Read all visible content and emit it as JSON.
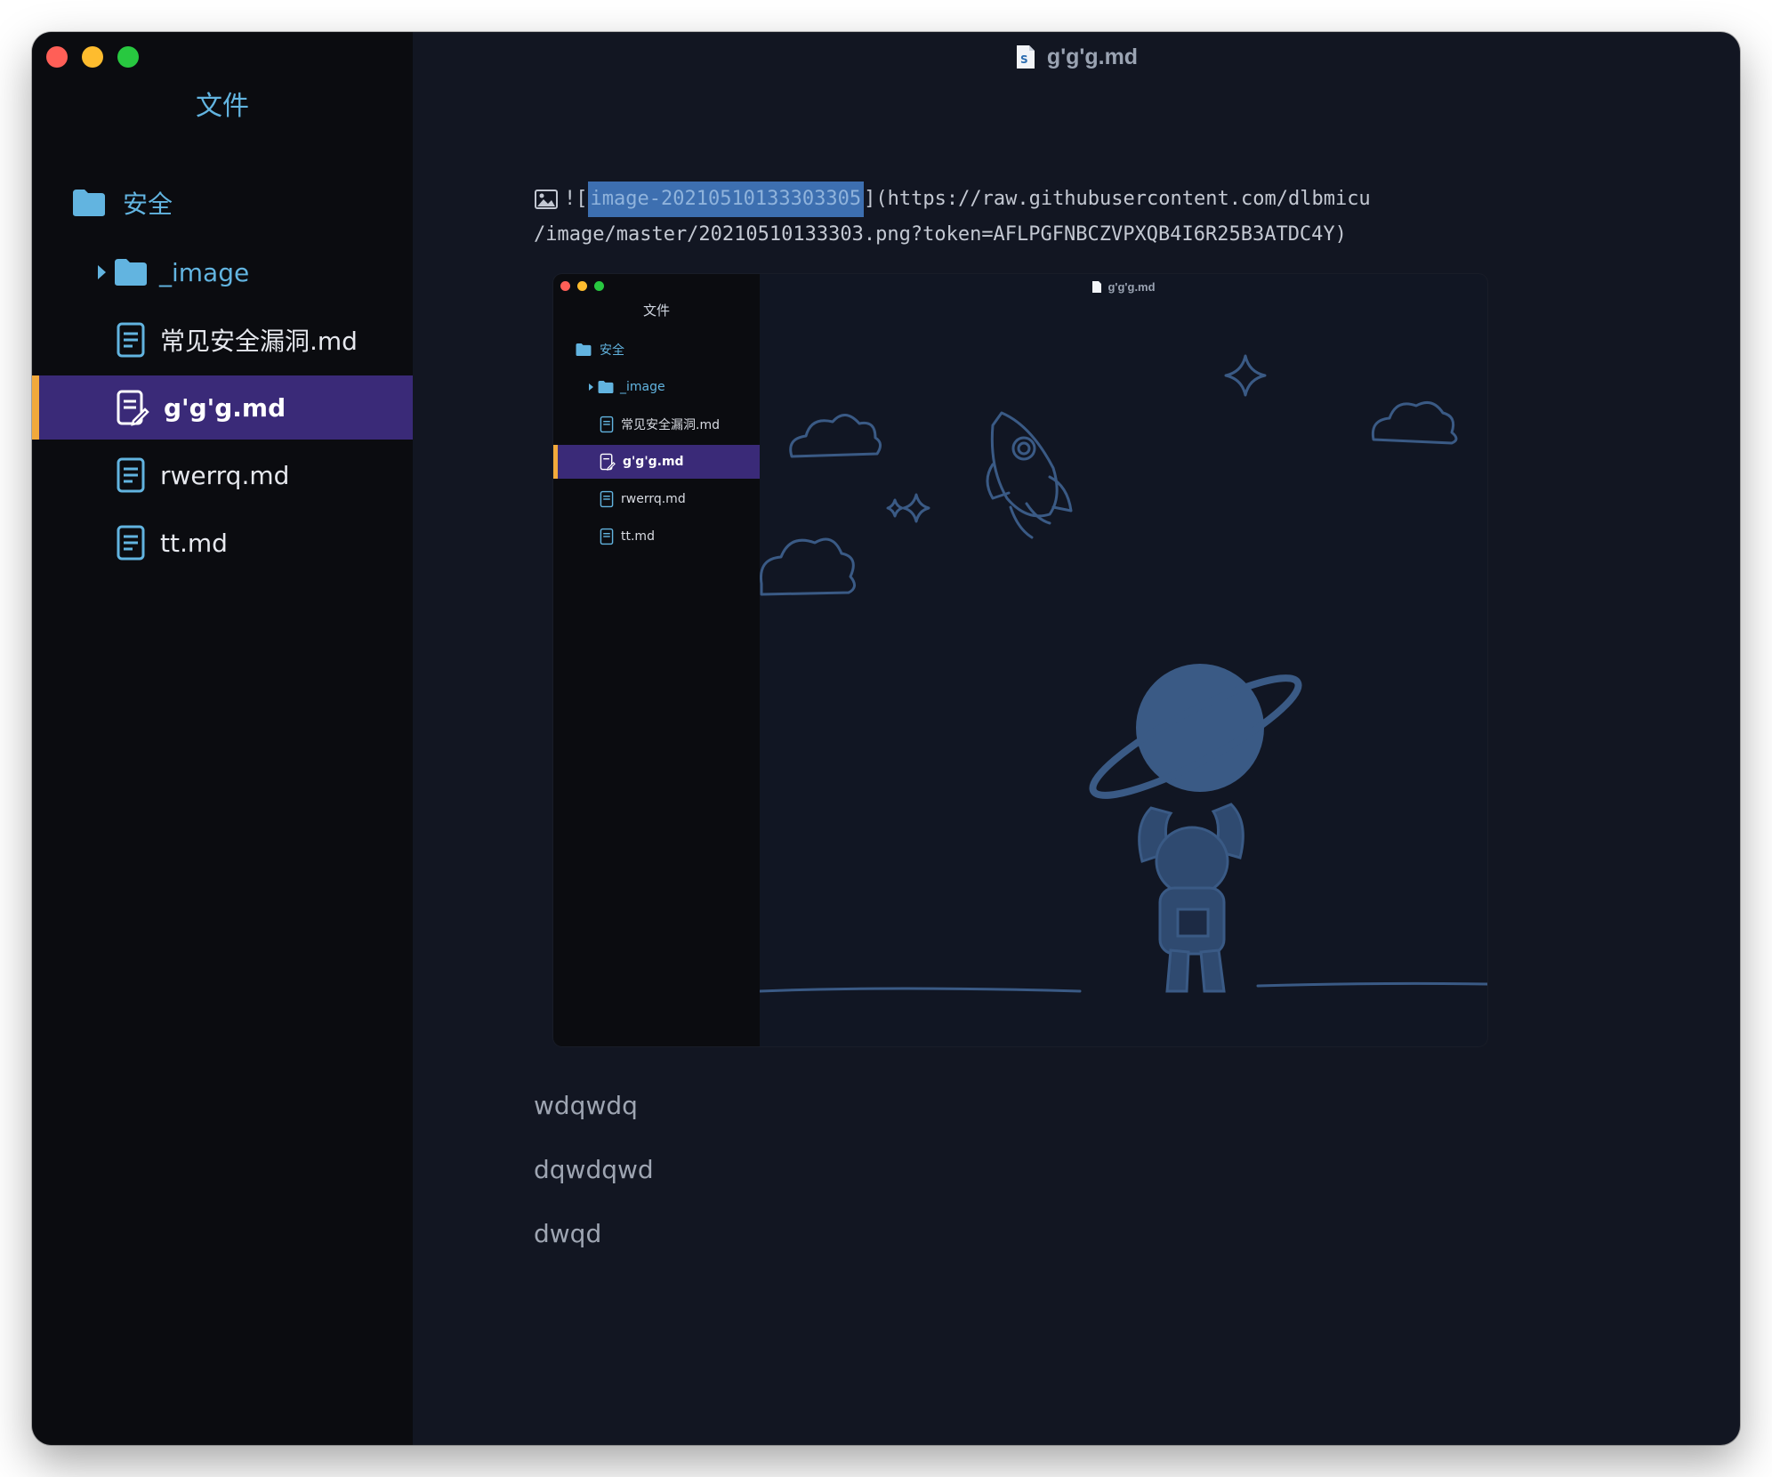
{
  "window": {
    "title": "g'g'g.md",
    "title_icon": "markdown-file-icon"
  },
  "sidebar": {
    "title": "文件",
    "items": [
      {
        "label": "安全",
        "icon": "folder-icon"
      },
      {
        "label": "_image",
        "icon": "folder-icon"
      },
      {
        "label": "常见安全漏洞.md",
        "icon": "document-icon"
      },
      {
        "label": "g'g'g.md",
        "icon": "document-edit-icon",
        "active": true
      },
      {
        "label": "rwerrq.md",
        "icon": "document-icon"
      },
      {
        "label": "tt.md",
        "icon": "document-icon"
      }
    ]
  },
  "editor": {
    "image_source": {
      "prefix": "![",
      "alt_selected": "image-20210510133303305",
      "suffix_line1": "](https://raw.githubusercontent.com/dlbmicu",
      "line2": "/image/master/20210510133303.png?token=AFLPGFNBCZVPXQB4I6R25B3ATDC4Y)"
    },
    "preview": {
      "title": "g'g'g.md",
      "sidebar_title": "文件",
      "items": [
        "安全",
        "_image",
        "常见安全漏洞.md",
        "g'g'g.md",
        "rwerrq.md",
        "tt.md"
      ]
    },
    "paragraphs": [
      "wdqwdq",
      "dqwdqwd",
      "dwqd"
    ]
  },
  "colors": {
    "accent_purple": "#3a2a78",
    "accent_orange": "#f2a93b",
    "folder_blue": "#62b4e0",
    "illustration_blue": "#3a5a85"
  }
}
